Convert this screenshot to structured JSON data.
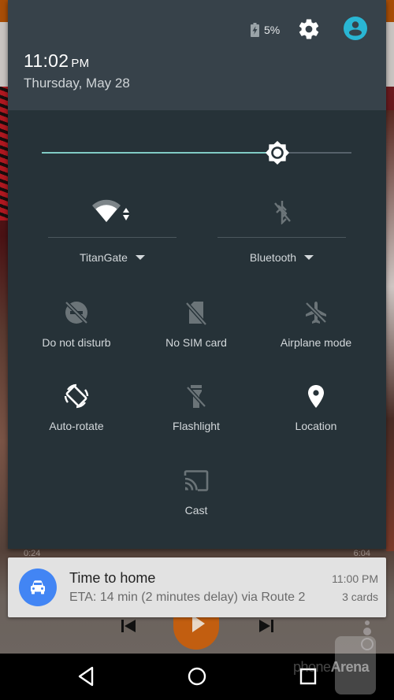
{
  "status": {
    "battery_percent": "5%",
    "battery_icon": "battery-charging-icon",
    "settings_icon": "gear-icon",
    "account_icon": "account-circle-icon",
    "accent_color": "#29b6d4"
  },
  "header": {
    "time": "11:02",
    "ampm": "PM",
    "date": "Thursday, May 28"
  },
  "brightness": {
    "level_percent": 76,
    "icon": "brightness-icon",
    "fill_color": "#80cbc4"
  },
  "wifi": {
    "label": "TitanGate",
    "icon": "wifi-icon",
    "state": "connected"
  },
  "bluetooth": {
    "label": "Bluetooth",
    "icon": "bluetooth-disabled-icon",
    "state": "off"
  },
  "tiles": [
    {
      "label": "Do not disturb",
      "icon": "do-not-disturb-off-icon",
      "active": false
    },
    {
      "label": "No SIM card",
      "icon": "no-sim-icon",
      "active": false
    },
    {
      "label": "Airplane mode",
      "icon": "airplane-off-icon",
      "active": false
    },
    {
      "label": "Auto-rotate",
      "icon": "screen-rotation-icon",
      "active": true
    },
    {
      "label": "Flashlight",
      "icon": "flashlight-off-icon",
      "active": false
    },
    {
      "label": "Location",
      "icon": "location-pin-icon",
      "active": true
    },
    {
      "label": "Cast",
      "icon": "cast-icon",
      "active": false
    }
  ],
  "notification": {
    "title": "Time to home",
    "text": "ETA: 14 min (2 minutes delay) via Route 2",
    "time": "11:00 PM",
    "count": "3 cards",
    "icon": "car-icon",
    "icon_color": "#4285f4"
  },
  "background_app": {
    "elapsed": "0:24",
    "duration": "6:04"
  },
  "navbar": {
    "back_icon": "back-triangle-icon",
    "home_icon": "home-circle-icon",
    "recents_icon": "recents-square-icon"
  },
  "watermark": {
    "part1": "phone",
    "part2": "Arena"
  }
}
